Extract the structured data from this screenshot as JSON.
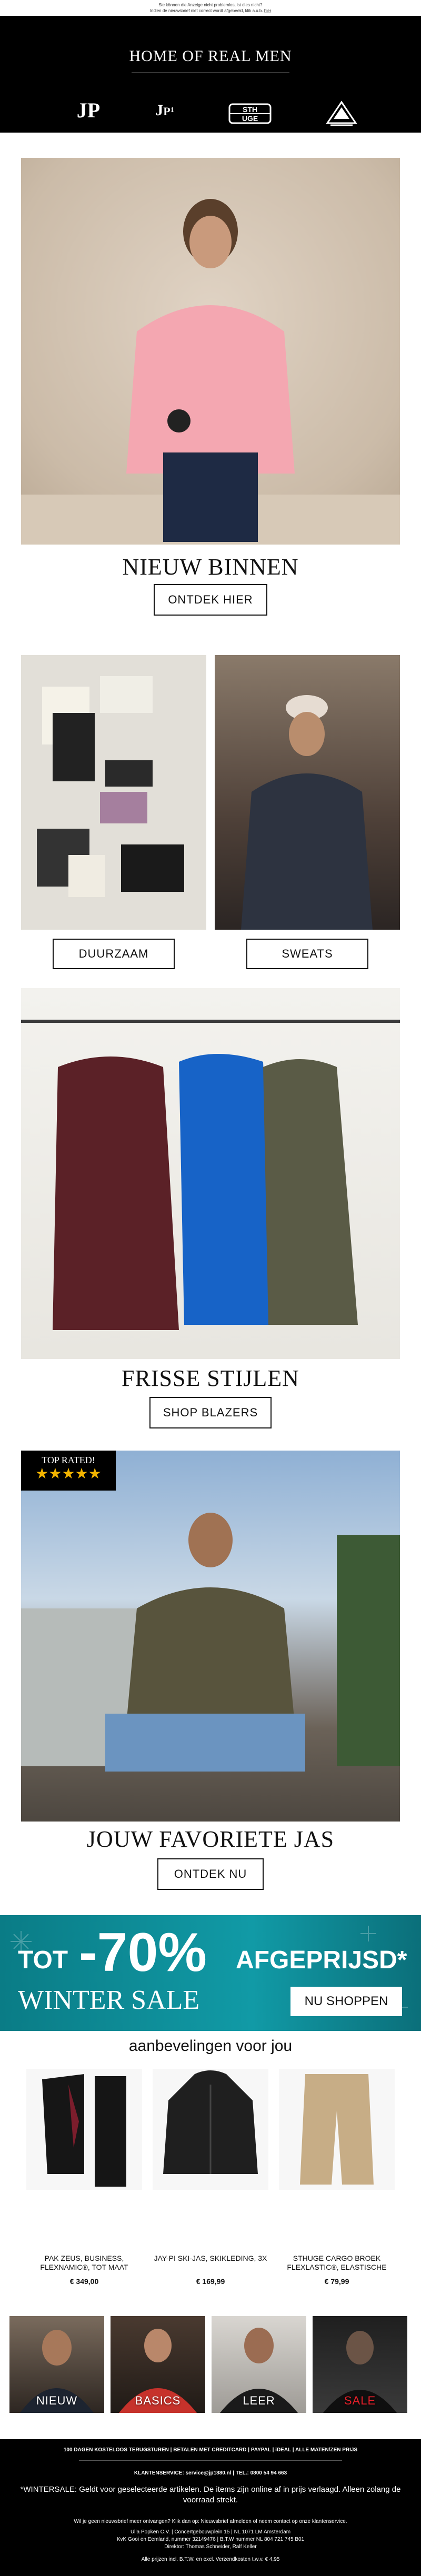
{
  "preheader": {
    "line1": "Sie können die Anzeige nicht problemlos, ist dies nicht?",
    "line2_prefix": "Indien de nieuwsbrief niet correct wordt afgebeeld, klik a.u.b.",
    "line2_link": "hier"
  },
  "header": {
    "title": "HOME OF REAL MEN",
    "brands": [
      "JP",
      "JP|1880",
      "STHUGE",
      "JAY-PI"
    ]
  },
  "hero": {
    "title": "NIEUW BINNEN",
    "button": "ONTDEK HIER"
  },
  "duo": {
    "left_button": "DUURZAAM",
    "right_button": "SWEATS"
  },
  "blazers": {
    "title": "FRISSE STIJLEN",
    "button": "SHOP BLAZERS"
  },
  "jacket": {
    "badge": "TOP RATED!",
    "stars": "★★★★★",
    "title": "JOUW FAVORIETE JAS",
    "button": "ONTDEK NU"
  },
  "promo": {
    "prefix": "TOT",
    "percent": "-70%",
    "suffix": "AFGEPRIJSD*",
    "sale": "WINTER SALE",
    "button": "NU SHOPPEN"
  },
  "recommendations": {
    "title": "aanbevelingen voor jou",
    "items": [
      {
        "name": "PAK ZEUS, BUSINESS, FLEXNAMIC®, TOT MAAT",
        "price": "€ 349,00"
      },
      {
        "name": "JAY-PI SKI-JAS, SKIKLEDING, 3X",
        "price": "€ 169,99"
      },
      {
        "name": "STHUGE CARGO BROEK FLEXLASTIC®, ELASTISCHE",
        "price": "€ 79,99"
      }
    ]
  },
  "categories": [
    "NIEUW",
    "BASICS",
    "LEER",
    "SALE"
  ],
  "footer": {
    "services": "100 DAGEN KOSTELOOS TERUGSTUREN  |  BETALEN MET CREDITCARD  |  PAYPAL  |  iDEAL  |  ALLE MATEN/ZEN PRIJS",
    "contact": "KLANTENSERVICE: service@jp1880.nl  |  TEL.: 0800 54 94 663",
    "disclaimer": "*WINTERSALE: Geldt voor geselecteerde artikelen. De items zijn online af in prijs verlaagd. Alleen zolang de voorraad strekt.",
    "unsubscribe": "Wil je geen nieuwsbrief meer ontvangen? Klik dan op: Nieuwsbrief afmelden of neem contact op onze klantenservice.",
    "address1": "Ulla Popken C.V. | Concertgebouwplein 15 | NL 1071 LM Amsterdam",
    "address2": "KvK Gooi en Eemland, nummer 32149476 | B.T.W nummer NL 804 721 745 B01",
    "directors": "Direktor: Thomas Schneider, Ralf Keller",
    "vat": "Alle prijzen incl. B.T.W. en excl. Verzendkosten t.w.v. € 4,95"
  }
}
